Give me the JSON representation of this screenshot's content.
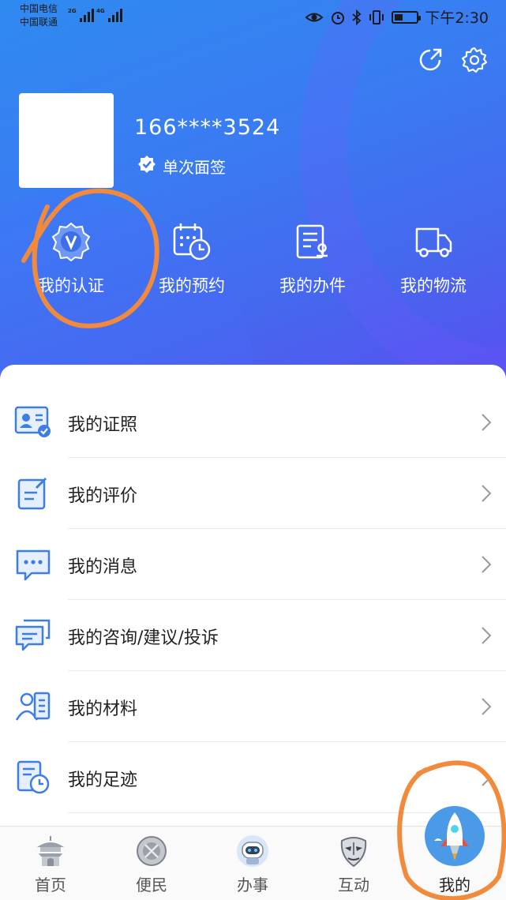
{
  "status_bar": {
    "carrier_1": "中国电信",
    "carrier_2": "中国联通",
    "net_1": "2G",
    "net_2": "4G",
    "time": "下午2:30"
  },
  "profile": {
    "phone": "166****3524",
    "verify_label": "单次面签"
  },
  "quick_actions": [
    {
      "label": "我的认证",
      "icon": "verify-badge-icon"
    },
    {
      "label": "我的预约",
      "icon": "calendar-clock-icon"
    },
    {
      "label": "我的办件",
      "icon": "document-stamp-icon"
    },
    {
      "label": "我的物流",
      "icon": "truck-icon"
    }
  ],
  "menu": [
    {
      "label": "我的证照",
      "icon": "id-card-icon"
    },
    {
      "label": "我的评价",
      "icon": "edit-note-icon"
    },
    {
      "label": "我的消息",
      "icon": "message-icon"
    },
    {
      "label": "我的咨询/建议/投诉",
      "icon": "chat-bubbles-icon"
    },
    {
      "label": "我的材料",
      "icon": "user-list-icon"
    },
    {
      "label": "我的足迹",
      "icon": "history-icon"
    }
  ],
  "bottom_nav": [
    {
      "label": "首页",
      "icon": "pagoda-icon"
    },
    {
      "label": "便民",
      "icon": "service-icon"
    },
    {
      "label": "办事",
      "icon": "robot-icon"
    },
    {
      "label": "互动",
      "icon": "opera-mask-icon"
    },
    {
      "label": "我的",
      "icon": "rocket-icon",
      "active": true
    }
  ],
  "colors": {
    "header_start": "#2f8af0",
    "header_end": "#5a4ef0",
    "icon_blue": "#3c7de8",
    "annotation": "#f28a3c"
  }
}
